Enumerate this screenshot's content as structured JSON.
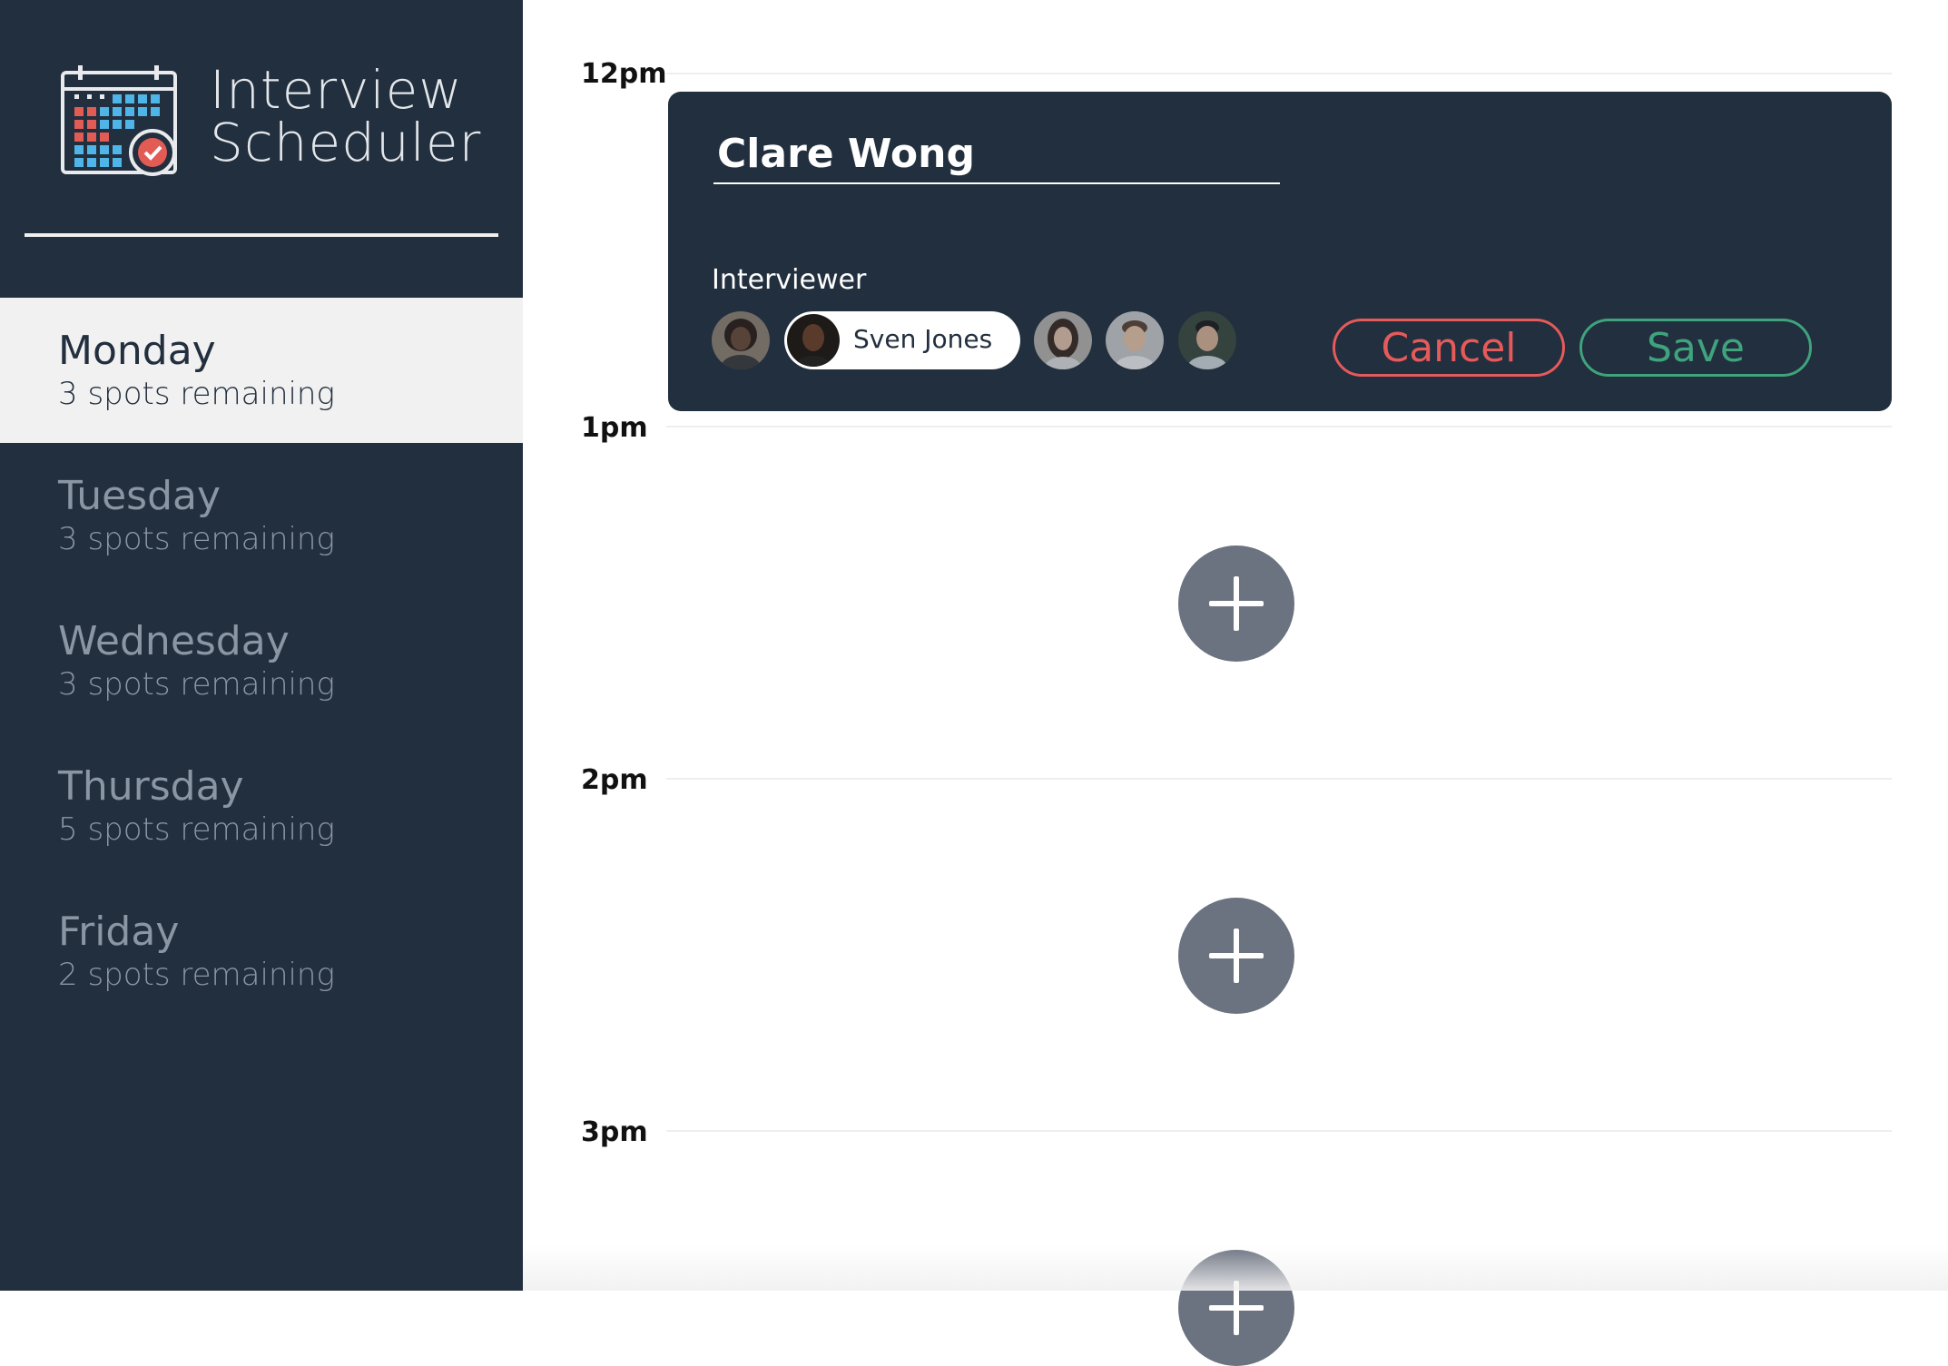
{
  "brand": {
    "line1": "Interview",
    "line2": "Scheduler",
    "logo_icon": "calendar-check-icon"
  },
  "days": [
    {
      "name": "Monday",
      "spots": "3 spots remaining",
      "selected": true
    },
    {
      "name": "Tuesday",
      "spots": "3 spots remaining",
      "selected": false
    },
    {
      "name": "Wednesday",
      "spots": "3 spots remaining",
      "selected": false
    },
    {
      "name": "Thursday",
      "spots": "5 spots remaining",
      "selected": false
    },
    {
      "name": "Friday",
      "spots": "2 spots remaining",
      "selected": false
    }
  ],
  "schedule": {
    "hours": [
      "12pm",
      "1pm",
      "2pm",
      "3pm"
    ]
  },
  "form": {
    "student_name": "Clare Wong",
    "interviewer_label": "Interviewer",
    "selected_interviewer": "Sven Jones",
    "cancel_label": "Cancel",
    "save_label": "Save"
  },
  "colors": {
    "sidebar_bg": "#222f3e",
    "selected_day_bg": "#f1f1f1",
    "cancel": "#e55a5a",
    "save": "#3fa37d",
    "add_button": "#6b7280"
  },
  "icons": {
    "add": "plus-icon"
  }
}
